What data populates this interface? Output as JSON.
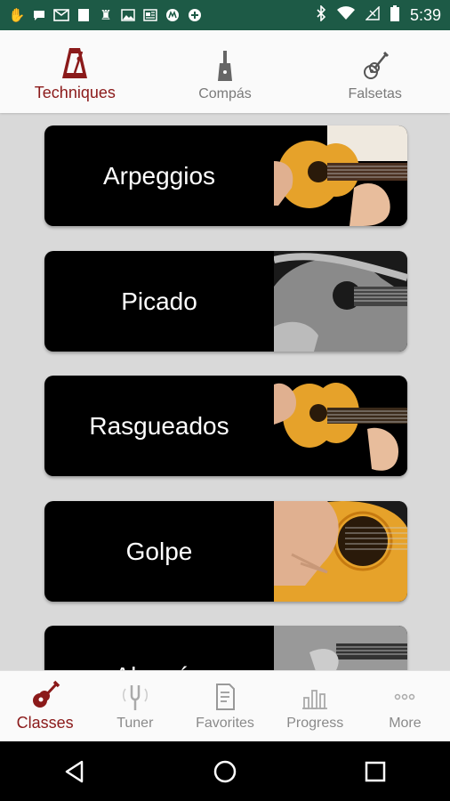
{
  "status_bar": {
    "time": "5:39",
    "icons_left": [
      "hand-icon",
      "chat-icon",
      "mail-icon",
      "square-icon",
      "chess-icon",
      "image-icon",
      "news-icon",
      "motorola-icon",
      "plus-icon"
    ],
    "icons_right": [
      "bluetooth-icon",
      "wifi-icon",
      "signal-icon",
      "battery-icon"
    ]
  },
  "top_tabs": [
    {
      "label": "Techniques",
      "icon": "metronome-icon",
      "active": true
    },
    {
      "label": "Compás",
      "icon": "cajon-icon",
      "active": false
    },
    {
      "label": "Falsetas",
      "icon": "guitar-icon",
      "active": false
    }
  ],
  "cards": [
    {
      "label": "Arpeggios"
    },
    {
      "label": "Picado"
    },
    {
      "label": "Rasgueados"
    },
    {
      "label": "Golpe"
    },
    {
      "label": "Alzapúa"
    }
  ],
  "bottom_nav": [
    {
      "label": "Classes",
      "icon": "guitar-icon",
      "active": true
    },
    {
      "label": "Tuner",
      "icon": "tuning-fork-icon",
      "active": false
    },
    {
      "label": "Favorites",
      "icon": "document-icon",
      "active": false
    },
    {
      "label": "Progress",
      "icon": "bar-chart-icon",
      "active": false
    },
    {
      "label": "More",
      "icon": "more-dots-icon",
      "active": false
    }
  ],
  "colors": {
    "status_bar": "#1d5a46",
    "accent": "#8b1a1a",
    "inactive": "#8a8a8a",
    "background": "#d9d9d9"
  }
}
